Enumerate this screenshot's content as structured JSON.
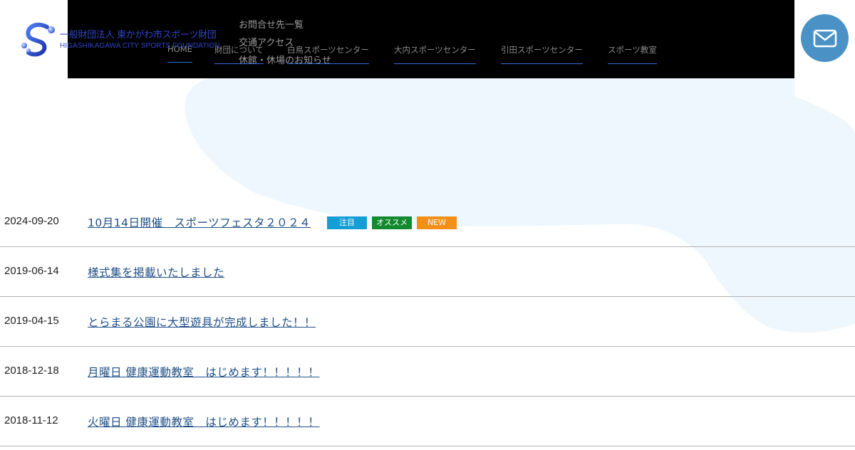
{
  "brand": {
    "name_jp": "一般財団法人 東かがわ市スポーツ財団",
    "name_en": "HIGASHIKAGAWA CITY SPORTS FOUNDATION",
    "logo_icon": "foundation-logo-icon"
  },
  "nav": {
    "items": [
      {
        "label": "HOME"
      },
      {
        "label": "財団について"
      },
      {
        "label": "白鳥スポーツセンター"
      },
      {
        "label": "大内スポーツセンター"
      },
      {
        "label": "引田スポーツセンター"
      },
      {
        "label": "スポーツ教室"
      }
    ],
    "sub_links": [
      {
        "label": "お問合せ先一覧"
      },
      {
        "label": "交通アクセス"
      },
      {
        "label": "休館・休場のお知らせ"
      }
    ]
  },
  "contact": {
    "icon": "mail-icon"
  },
  "news": [
    {
      "date": "2024-09-20",
      "title": "10月14日開催　スポーツフェスタ２０２４",
      "tags": [
        {
          "label": "注目",
          "color": "#139ed6"
        },
        {
          "label": "オススメ",
          "color": "#138a2e"
        },
        {
          "label": "NEW",
          "color": "#f39019"
        }
      ]
    },
    {
      "date": "2019-06-14",
      "title": "様式集を掲載いたしました"
    },
    {
      "date": "2019-04-15",
      "title": "とらまる公園に大型遊具が完成しました！！"
    },
    {
      "date": "2018-12-18",
      "title": "月曜日 健康運動教室　はじめます！！！！！"
    },
    {
      "date": "2018-11-12",
      "title": "火曜日 健康運動教室　はじめます！！！！！"
    }
  ],
  "colors": {
    "top_bar": "#000000",
    "link": "#1f4f86",
    "mail_button": "#4a92c6",
    "background_shape": "#eef7fd"
  }
}
